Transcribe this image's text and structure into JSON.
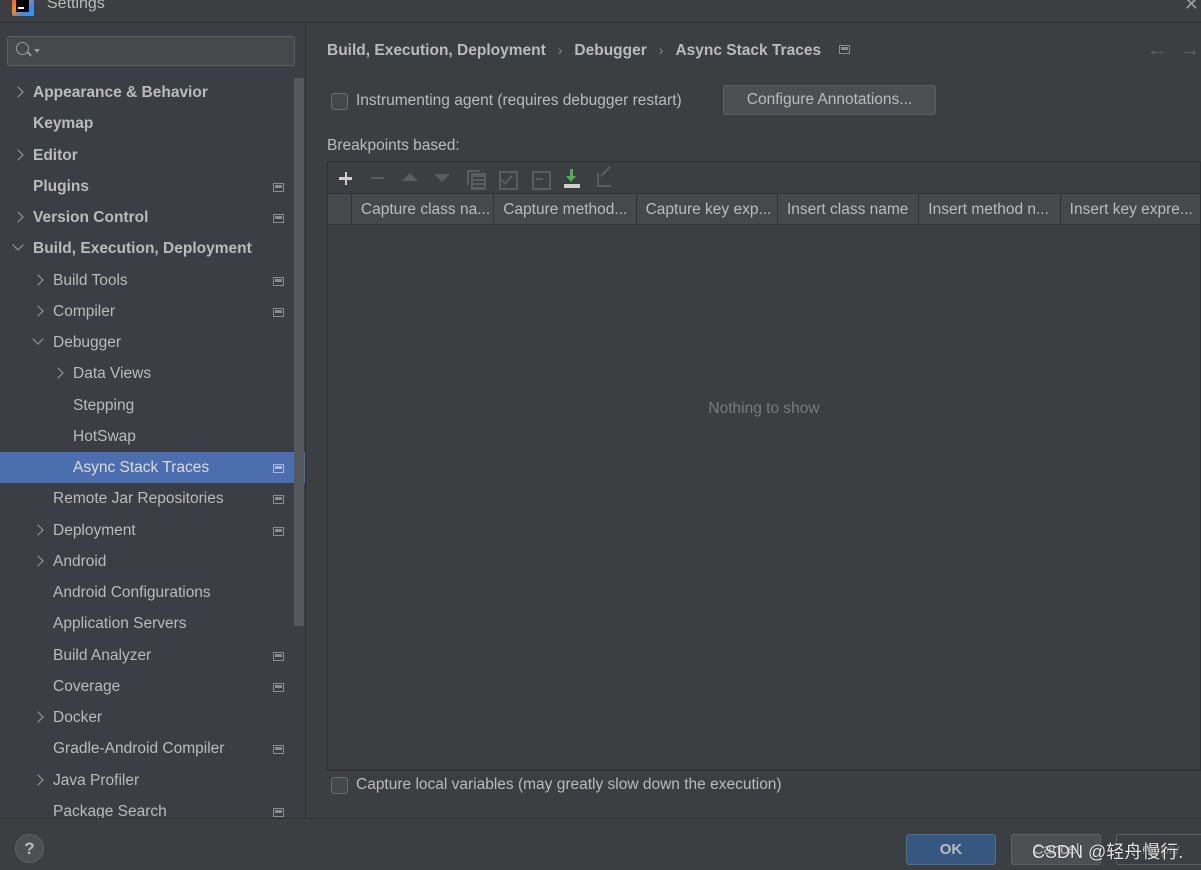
{
  "window": {
    "title": "Settings",
    "logo_icon": "intellij-idea-logo",
    "close_icon": "close-icon"
  },
  "sidebar": {
    "search": {
      "value": "",
      "placeholder": ""
    },
    "items": [
      {
        "label": "Appearance & Behavior",
        "level": 0,
        "expander": "collapsed",
        "bold": true,
        "project_icon": false
      },
      {
        "label": "Keymap",
        "level": 0,
        "expander": "none",
        "bold": true,
        "project_icon": false
      },
      {
        "label": "Editor",
        "level": 0,
        "expander": "collapsed",
        "bold": true,
        "project_icon": false
      },
      {
        "label": "Plugins",
        "level": 0,
        "expander": "none",
        "bold": true,
        "project_icon": true
      },
      {
        "label": "Version Control",
        "level": 0,
        "expander": "collapsed",
        "bold": true,
        "project_icon": true
      },
      {
        "label": "Build, Execution, Deployment",
        "level": 0,
        "expander": "expanded",
        "bold": true,
        "project_icon": false
      },
      {
        "label": "Build Tools",
        "level": 1,
        "expander": "collapsed",
        "bold": false,
        "project_icon": true
      },
      {
        "label": "Compiler",
        "level": 1,
        "expander": "collapsed",
        "bold": false,
        "project_icon": true
      },
      {
        "label": "Debugger",
        "level": 1,
        "expander": "expanded",
        "bold": false,
        "project_icon": false
      },
      {
        "label": "Data Views",
        "level": 2,
        "expander": "collapsed",
        "bold": false,
        "project_icon": false
      },
      {
        "label": "Stepping",
        "level": 2,
        "expander": "none",
        "bold": false,
        "project_icon": false
      },
      {
        "label": "HotSwap",
        "level": 2,
        "expander": "none",
        "bold": false,
        "project_icon": false
      },
      {
        "label": "Async Stack Traces",
        "level": 2,
        "expander": "none",
        "bold": false,
        "project_icon": true,
        "selected": true
      },
      {
        "label": "Remote Jar Repositories",
        "level": 1,
        "expander": "none",
        "bold": false,
        "project_icon": true
      },
      {
        "label": "Deployment",
        "level": 1,
        "expander": "collapsed",
        "bold": false,
        "project_icon": true
      },
      {
        "label": "Android",
        "level": 1,
        "expander": "collapsed",
        "bold": false,
        "project_icon": false
      },
      {
        "label": "Android Configurations",
        "level": 1,
        "expander": "none",
        "bold": false,
        "project_icon": false
      },
      {
        "label": "Application Servers",
        "level": 1,
        "expander": "none",
        "bold": false,
        "project_icon": false
      },
      {
        "label": "Build Analyzer",
        "level": 1,
        "expander": "none",
        "bold": false,
        "project_icon": true
      },
      {
        "label": "Coverage",
        "level": 1,
        "expander": "none",
        "bold": false,
        "project_icon": true
      },
      {
        "label": "Docker",
        "level": 1,
        "expander": "collapsed",
        "bold": false,
        "project_icon": false
      },
      {
        "label": "Gradle-Android Compiler",
        "level": 1,
        "expander": "none",
        "bold": false,
        "project_icon": true
      },
      {
        "label": "Java Profiler",
        "level": 1,
        "expander": "collapsed",
        "bold": false,
        "project_icon": false
      },
      {
        "label": "Package Search",
        "level": 1,
        "expander": "none",
        "bold": false,
        "project_icon": true
      }
    ]
  },
  "main": {
    "breadcrumb": [
      "Build, Execution, Deployment",
      "Debugger",
      "Async Stack Traces"
    ],
    "instrumenting_agent": {
      "label": "Instrumenting agent (requires debugger restart)",
      "checked": false
    },
    "configure_annotations_label": "Configure Annotations...",
    "breakpoints_label": "Breakpoints based:",
    "toolbar_icons": [
      "add-icon",
      "remove-icon",
      "move-up-icon",
      "move-down-icon",
      "copy-icon",
      "check-all-icon",
      "uncheck-all-icon",
      "import-icon",
      "export-icon"
    ],
    "table": {
      "columns": [
        "Capture class na...",
        "Capture method...",
        "Capture key exp...",
        "Insert class name",
        "Insert method n...",
        "Insert key expre..."
      ],
      "rows": [],
      "empty_text": "Nothing to show"
    },
    "capture_local_vars": {
      "label": "Capture local variables (may greatly slow down the execution)",
      "checked": false
    }
  },
  "footer": {
    "help_label": "?",
    "ok_label": "OK",
    "cancel_label": "Cancel",
    "apply_label": "Apply",
    "watermark": "CSDN @轻舟慢行."
  },
  "colors": {
    "background": "#3c3f41",
    "selection": "#4b6eaf",
    "ok_button": "#365880",
    "text": "#bbbbbb",
    "import_icon": "#4caf50"
  }
}
